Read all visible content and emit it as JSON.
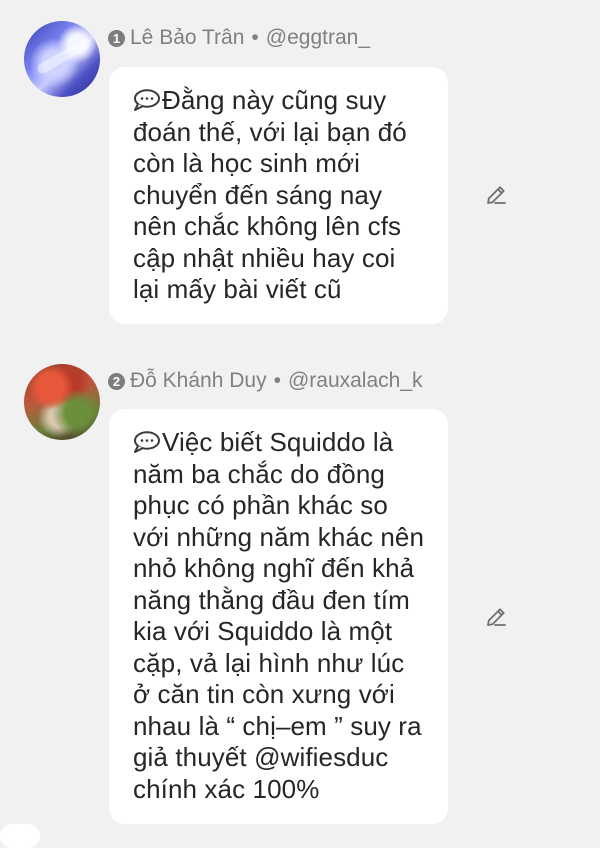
{
  "comments": [
    {
      "rank": "1",
      "name": "Lê Bảo Trân",
      "separator": "•",
      "handle": "@eggtran_",
      "avatar_icon": "user-avatar-blue-illustration",
      "text": "Đằng này cũng suy đoán thế, với lại bạn đó còn là học sinh mới chuyển đến sáng nay nên chắc không lên cfs cập nhật nhiều hay coi lại mấy bài viết cũ",
      "speech_icon": "speech-bubble-icon",
      "edit_icon": "pencil-icon"
    },
    {
      "rank": "2",
      "name": "Đỗ Khánh Duy",
      "separator": "•",
      "handle": "@rauxalach_k",
      "avatar_icon": "user-avatar-red-illustration",
      "text": "Việc biết Squiddo là năm ba chắc do đồng phục có phần khác so với những năm khác nên nhỏ không nghĩ đến khả năng thằng đầu đen tím kia với Squiddo là một cặp, vả lại hình như lúc ở căn tin còn xưng với nhau là “ chị–em ” suy ra giả thuyết @wifiesduc chính xác 100%",
      "speech_icon": "speech-bubble-icon",
      "edit_icon": "pencil-icon"
    }
  ],
  "colors": {
    "background": "#f1f1f2",
    "bubble": "#ffffff",
    "text": "#262626",
    "meta": "#808080"
  }
}
